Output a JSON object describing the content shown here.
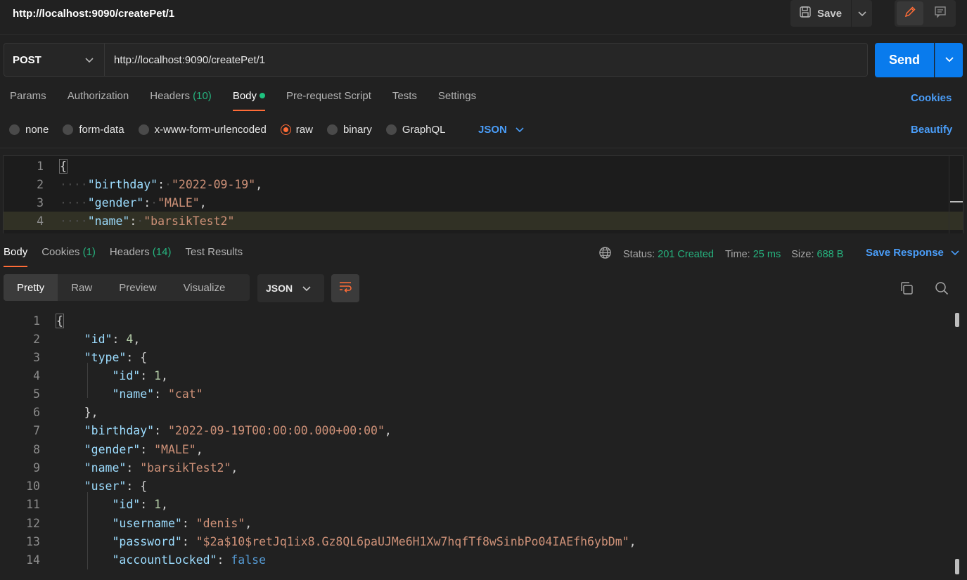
{
  "window": {
    "title": "http://localhost:9090/createPet/1",
    "save_label": "Save"
  },
  "request": {
    "method": "POST",
    "url": "http://localhost:9090/createPet/1",
    "send_label": "Send",
    "tabs": {
      "params": "Params",
      "authorization": "Authorization",
      "headers": "Headers",
      "headers_count": "(10)",
      "body": "Body",
      "prerequest": "Pre-request Script",
      "tests": "Tests",
      "settings": "Settings"
    },
    "cookies_label": "Cookies",
    "body_types": {
      "none": "none",
      "form_data": "form-data",
      "urlencoded": "x-www-form-urlencoded",
      "raw": "raw",
      "binary": "binary",
      "graphql": "GraphQL",
      "selected": "raw"
    },
    "raw_format": "JSON",
    "beautify_label": "Beautify",
    "body_lines": [
      "1",
      "2",
      "3",
      "4"
    ],
    "body_code": {
      "l1": "{",
      "l2_key": "\"birthday\"",
      "l2_val": "\"2022-09-19\"",
      "l3_key": "\"gender\"",
      "l3_val": "\"MALE\"",
      "l4_key": "\"name\"",
      "l4_val": "\"barsikTest2\""
    }
  },
  "response": {
    "tabs": {
      "body": "Body",
      "cookies": "Cookies",
      "cookies_count": "(1)",
      "headers": "Headers",
      "headers_count": "(14)",
      "test_results": "Test Results"
    },
    "status_label": "Status:",
    "status_value": "201 Created",
    "time_label": "Time:",
    "time_value": "25 ms",
    "size_label": "Size:",
    "size_value": "688 B",
    "save_response_label": "Save Response",
    "views": {
      "pretty": "Pretty",
      "raw": "Raw",
      "preview": "Preview",
      "visualize": "Visualize"
    },
    "format": "JSON",
    "line_numbers": [
      "1",
      "2",
      "3",
      "4",
      "5",
      "6",
      "7",
      "8",
      "9",
      "10",
      "11",
      "12",
      "13",
      "14"
    ],
    "code": {
      "id_key": "\"id\"",
      "id_val": "4",
      "type_key": "\"type\"",
      "type_id_key": "\"id\"",
      "type_id_val": "1",
      "type_name_key": "\"name\"",
      "type_name_val": "\"cat\"",
      "birthday_key": "\"birthday\"",
      "birthday_val": "\"2022-09-19T00:00:00.000+00:00\"",
      "gender_key": "\"gender\"",
      "gender_val": "\"MALE\"",
      "name_key": "\"name\"",
      "name_val": "\"barsikTest2\"",
      "user_key": "\"user\"",
      "user_id_key": "\"id\"",
      "user_id_val": "1",
      "username_key": "\"username\"",
      "username_val": "\"denis\"",
      "password_key": "\"password\"",
      "password_val": "\"$2a$10$retJq1ix8.Gz8QL6paUJMe6H1Xw7hqfTf8wSinbPo04IAEfh6ybDm\"",
      "locked_key": "\"accountLocked\"",
      "locked_val": "false"
    }
  },
  "colors": {
    "accent_orange": "#ff6c37",
    "send_blue": "#097bed",
    "link_blue": "#4a9df8",
    "status_green": "#26b47f"
  },
  "icons": [
    "save-icon",
    "chevron-down-icon",
    "pencil-icon",
    "comment-icon",
    "globe-icon",
    "wrap-lines-icon",
    "copy-icon",
    "search-icon"
  ]
}
